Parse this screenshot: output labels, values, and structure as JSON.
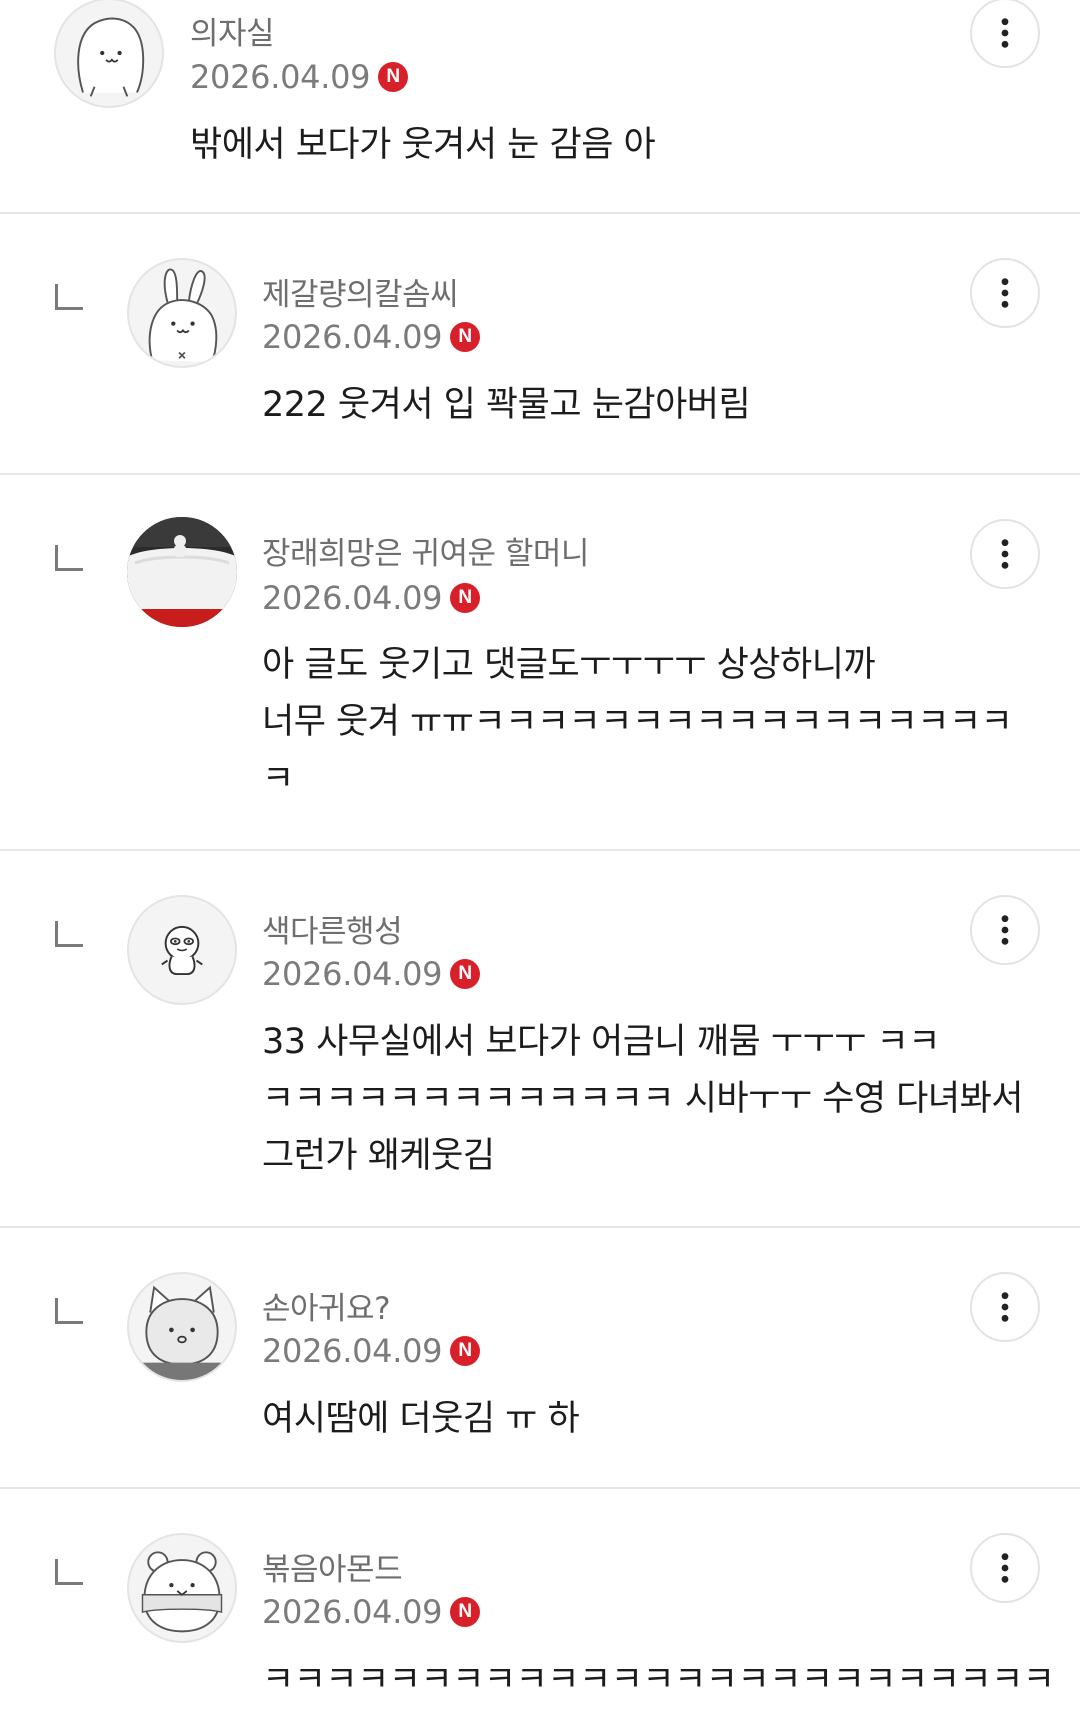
{
  "comments": [
    {
      "nickname": "의자실",
      "date": "2026.04.09",
      "badge": "N",
      "text": "밖에서 보다가 웃겨서 눈 감음 아",
      "avatar_icon": "blob-face-avatar-icon",
      "is_reply": false
    },
    {
      "nickname": "제갈량의칼솜씨",
      "date": "2026.04.09",
      "badge": "N",
      "text": "222 웃겨서 입 꽉물고 눈감아버림",
      "avatar_icon": "bunny-avatar-icon",
      "is_reply": true
    },
    {
      "nickname": "장래희망은 귀여운 할머니",
      "date": "2026.04.09",
      "badge": "N",
      "text": "아 글도 웃기고 댓글도ㅜㅜㅜㅜ 상상하니까\n너무 웃겨 ㅠㅠㅋㅋㅋㅋㅋㅋㅋㅋㅋㅋㅋㅋㅋㅋㅋㅋㅋ\nㅋ",
      "avatar_icon": "snow-photo-avatar-icon",
      "is_reply": true
    },
    {
      "nickname": "색다른행성",
      "date": "2026.04.09",
      "badge": "N",
      "text": "33 사무실에서 보다가 어금니 깨뭄 ㅜㅜㅜ ㅋㅋ\nㅋㅋㅋㅋㅋㅋㅋㅋㅋㅋㅋㅋㅋ 시바ㅜㅜ 수영 다녀봐서\n그런가 왜케웃김",
      "avatar_icon": "small-creature-avatar-icon",
      "is_reply": true
    },
    {
      "nickname": "손아귀요?",
      "date": "2026.04.09",
      "badge": "N",
      "text": "여시땀에 더웃김 ㅠ 하",
      "avatar_icon": "cat-avatar-icon",
      "is_reply": true
    },
    {
      "nickname": "볶음아몬드",
      "date": "2026.04.09",
      "badge": "N",
      "text": "ㅋㅋㅋㅋㅋㅋㅋㅋㅋㅋㅋㅋㅋㅋㅋㅋㅋㅋㅋㅋㅋㅋㅋㅋㅋ",
      "avatar_icon": "bear-avatar-icon",
      "is_reply": true
    }
  ],
  "colors": {
    "badge": "#d8202a",
    "nickname": "#6e6e6e",
    "date": "#7b7b7b",
    "divider": "#e6e6e6"
  }
}
